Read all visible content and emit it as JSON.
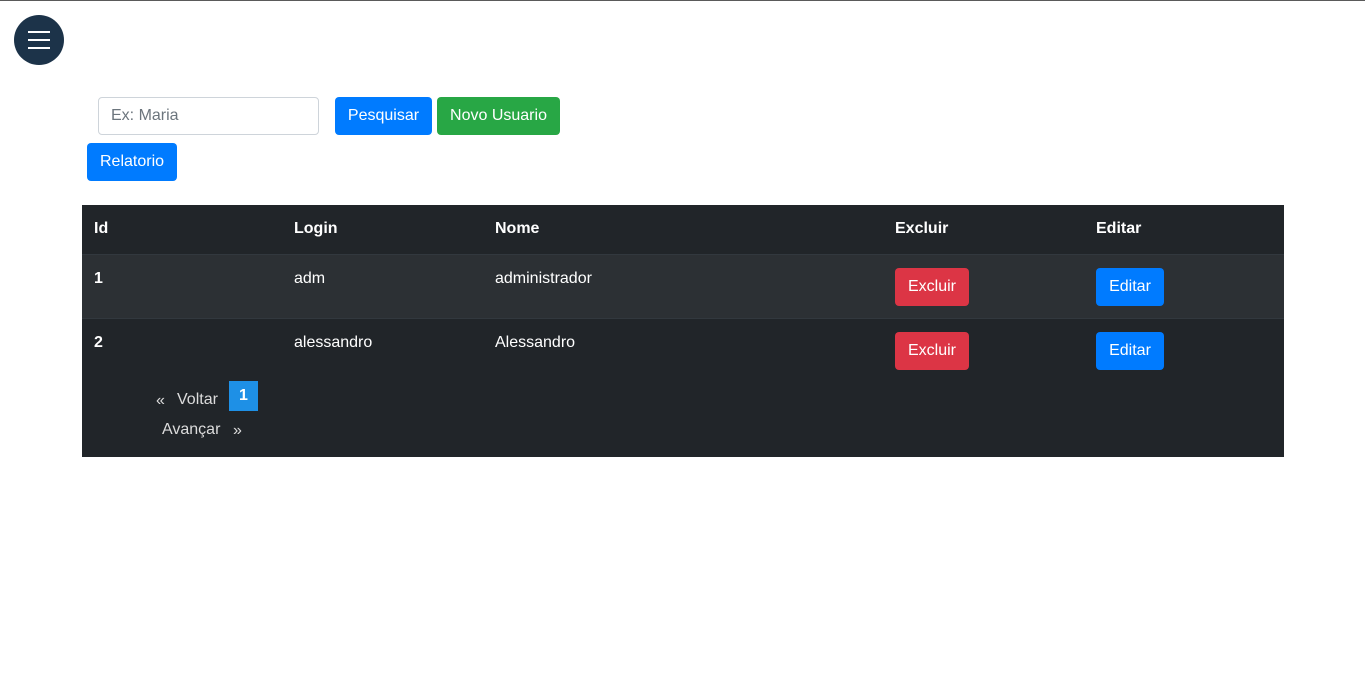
{
  "header": {
    "menu_icon": "hamburger-menu-icon"
  },
  "search": {
    "placeholder": "Ex: Maria",
    "value": "",
    "search_label": "Pesquisar",
    "new_user_label": "Novo Usuario",
    "report_label": "Relatorio"
  },
  "table": {
    "headers": [
      "Id",
      "Login",
      "Nome",
      "Excluir",
      "Editar"
    ],
    "rows": [
      {
        "id": "1",
        "login": "adm",
        "nome": "administrador",
        "delete_label": "Excluir",
        "edit_label": "Editar"
      },
      {
        "id": "2",
        "login": "alessandro",
        "nome": "Alessandro",
        "delete_label": "Excluir",
        "edit_label": "Editar"
      }
    ]
  },
  "pagination": {
    "prev_arrow": "«",
    "prev_label": "Voltar",
    "current_page": "1",
    "next_label": "Avançar",
    "next_arrow": "»"
  },
  "colors": {
    "menu_bg": "#1c3349",
    "primary": "#007bff",
    "success": "#28a745",
    "danger": "#dc3545",
    "table_bg": "#212529",
    "table_stripe": "#2c3034",
    "page_active": "#1e90e6"
  }
}
